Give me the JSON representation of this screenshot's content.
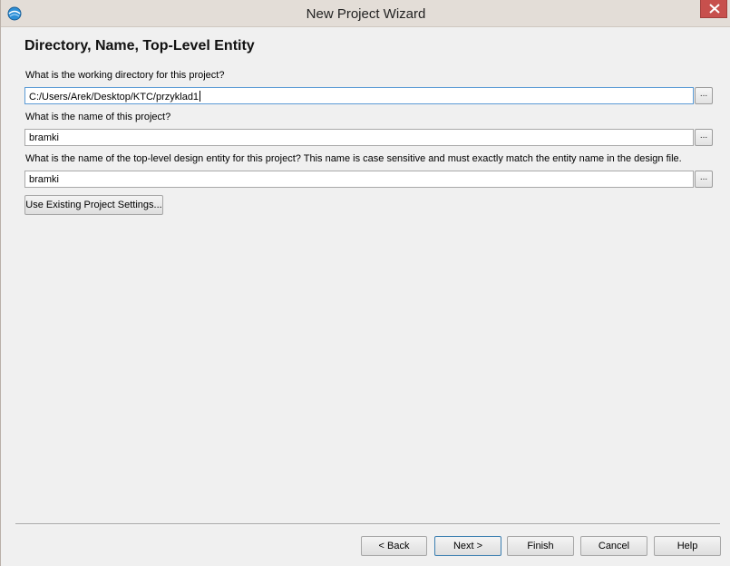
{
  "window": {
    "title": "New Project Wizard"
  },
  "page": {
    "heading": "Directory, Name, Top-Level Entity"
  },
  "directory": {
    "label": "What is the working directory for this project?",
    "value": "C:/Users/Arek/Desktop/KTC/przyklad1",
    "browse_label": "..."
  },
  "project_name": {
    "label": "What is the name of this project?",
    "value": "bramki",
    "browse_label": "..."
  },
  "top_level_entity": {
    "label": "What is the name of the top-level design entity for this project? This name is case sensitive and must exactly match the entity name in the design file.",
    "value": "bramki",
    "browse_label": "..."
  },
  "existing_settings_button": "Use Existing Project Settings...",
  "footer": {
    "back": "< Back",
    "next": "Next >",
    "finish": "Finish",
    "cancel": "Cancel",
    "help": "Help"
  },
  "colors": {
    "titlebar": "#e3ddd7",
    "close_button": "#c7504d",
    "focus_border": "#5b9bd5"
  },
  "icons": {
    "app": "quartus-globe-icon",
    "close": "close-icon"
  }
}
